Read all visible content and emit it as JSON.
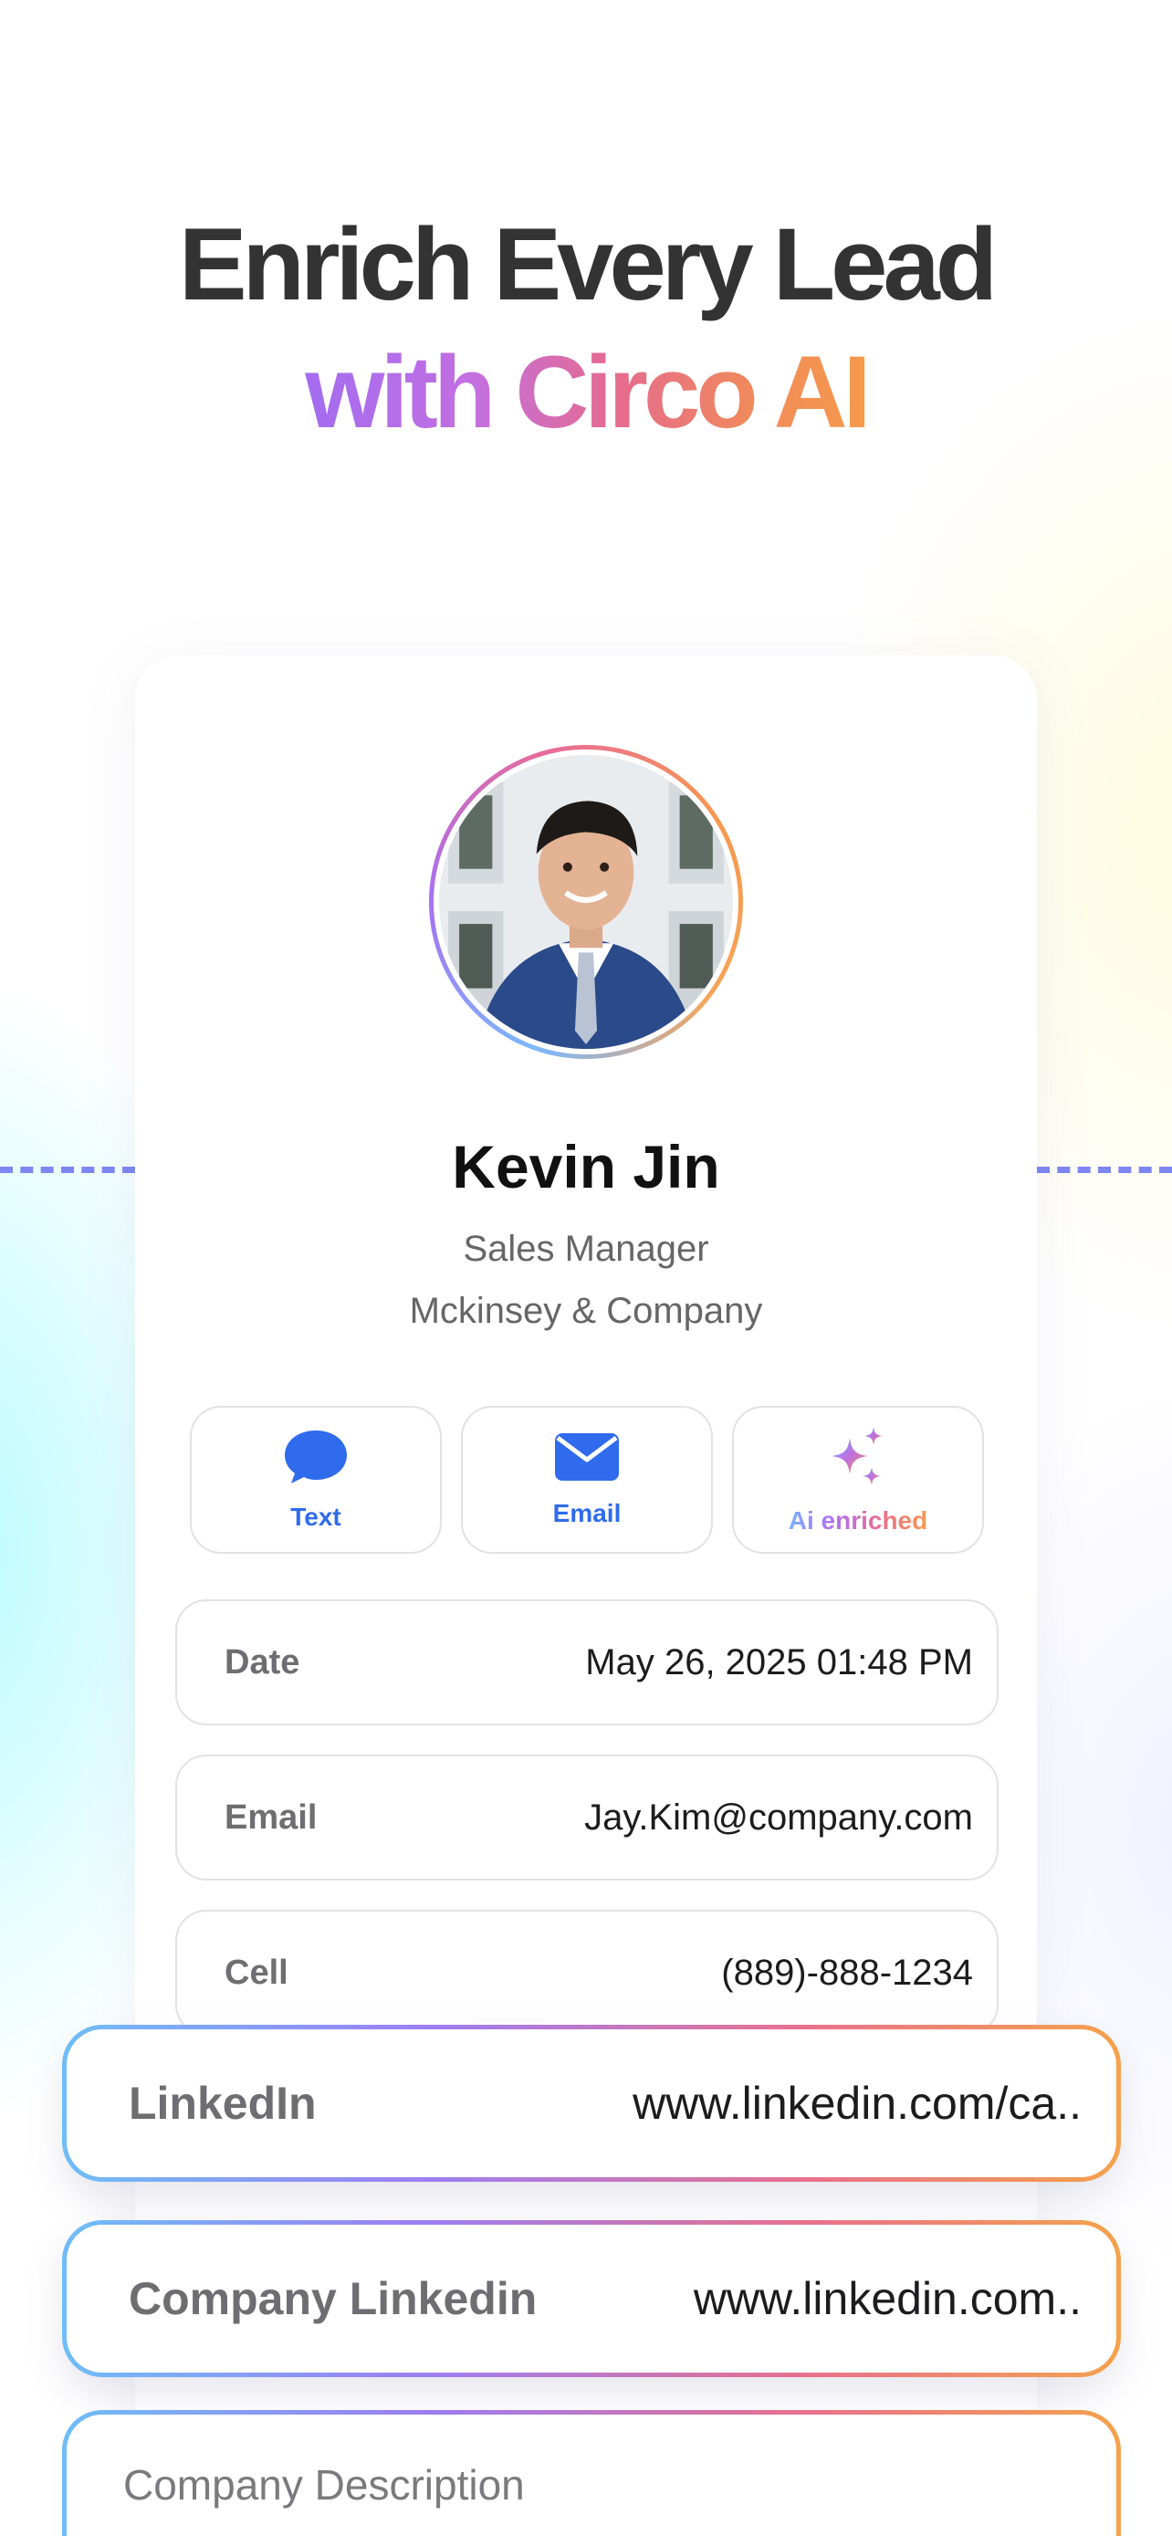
{
  "headline": {
    "line1": "Enrich Every Lead",
    "line2": "with Circo AI"
  },
  "profile": {
    "name": "Kevin Jin",
    "role": "Sales Manager",
    "company": "Mckinsey & Company"
  },
  "actions": [
    {
      "label": "Text",
      "icon": "chat-bubble-icon"
    },
    {
      "label": "Email",
      "icon": "envelope-icon"
    },
    {
      "label": "Ai enriched",
      "icon": "sparkle-icon"
    }
  ],
  "fields": [
    {
      "label": "Date",
      "value": "May 26, 2025 01:48 PM"
    },
    {
      "label": "Email",
      "value": "Jay.Kim@company.com"
    },
    {
      "label": "Cell",
      "value": "(889)-888-1234"
    }
  ],
  "enriched": [
    {
      "label": "LinkedIn",
      "value": "www.linkedin.com/ca.."
    },
    {
      "label": "Company Linkedin",
      "value": "www.linkedin.com.."
    }
  ],
  "description": {
    "label": "Company Description"
  },
  "colors": {
    "accent_blue": "#2f6bec",
    "dash": "#7d86f2",
    "gradient_start": "#a36cf0",
    "gradient_end": "#f59a4c"
  }
}
